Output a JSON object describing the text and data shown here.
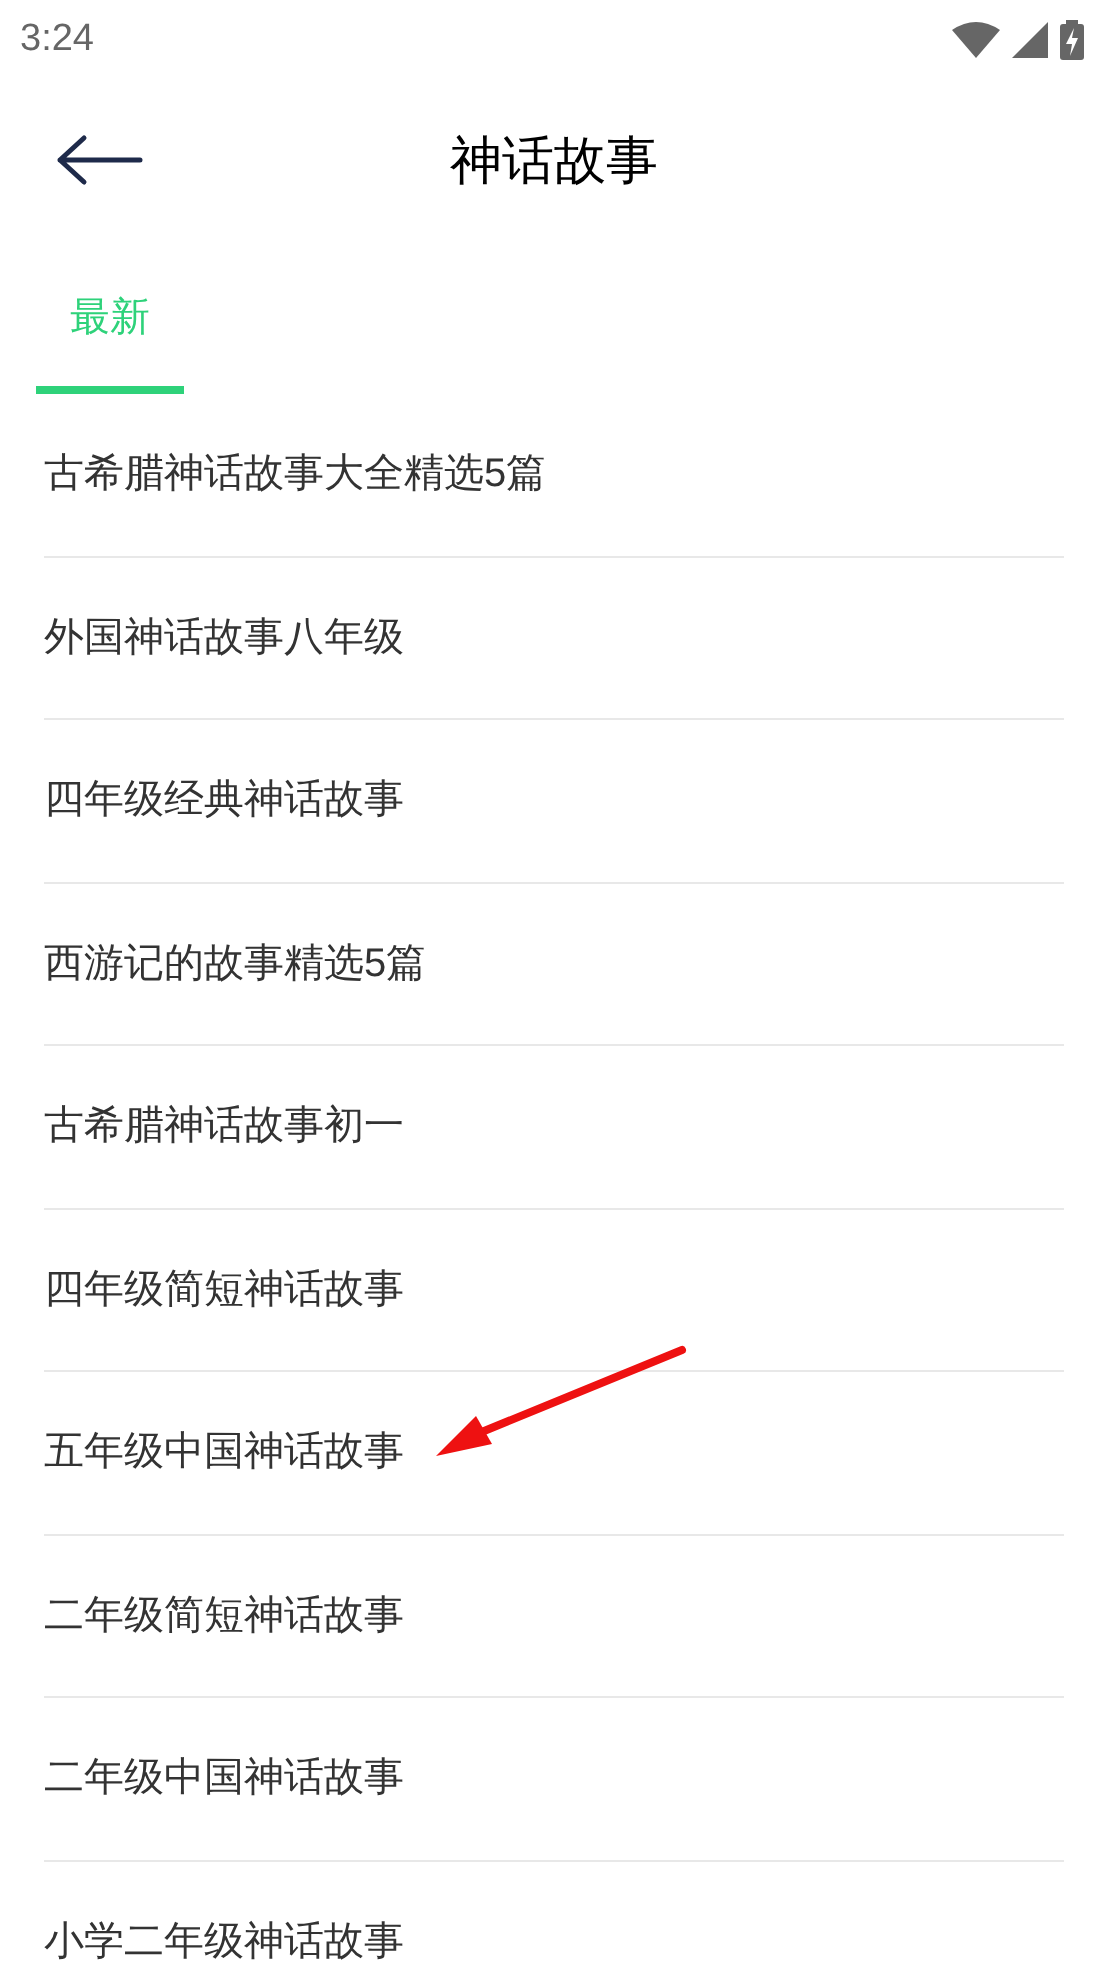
{
  "status_bar": {
    "time": "3:24"
  },
  "header": {
    "title": "神话故事"
  },
  "tabs": [
    {
      "label": "最新",
      "selected": true
    }
  ],
  "items": [
    {
      "title": "古希腊神话故事大全精选5篇"
    },
    {
      "title": "外国神话故事八年级"
    },
    {
      "title": "四年级经典神话故事"
    },
    {
      "title": "西游记的故事精选5篇"
    },
    {
      "title": "古希腊神话故事初一"
    },
    {
      "title": "四年级简短神话故事"
    },
    {
      "title": "五年级中国神话故事"
    },
    {
      "title": "二年级简短神话故事"
    },
    {
      "title": "二年级中国神话故事"
    },
    {
      "title": "小学二年级神话故事"
    }
  ]
}
